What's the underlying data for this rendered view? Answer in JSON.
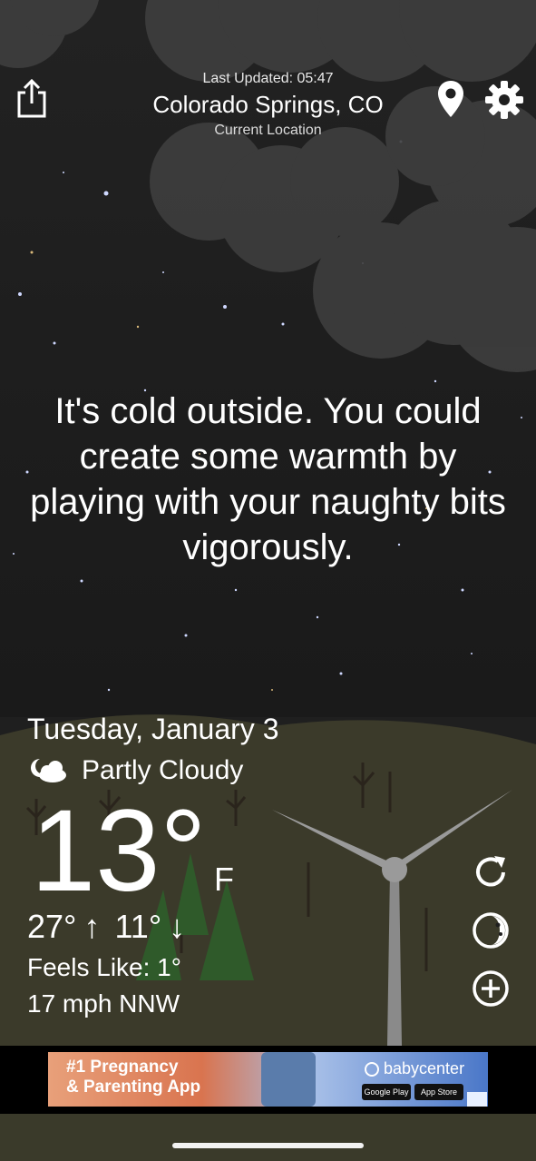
{
  "header": {
    "last_updated": "Last Updated: 05:47",
    "city": "Colorado Springs, CO",
    "location_label": "Current Location"
  },
  "icons": {
    "share": "share-icon",
    "pin": "location-pin-icon",
    "settings": "gear-icon",
    "refresh": "refresh-icon",
    "moon_phase": "moon-phase-icon",
    "add": "plus-circle-icon"
  },
  "message": "It's cold outside. You could create some warmth by playing with your naughty bits vigorously.",
  "weather": {
    "date": "Tuesday, January 3",
    "condition": "Partly Cloudy",
    "temperature": "13°",
    "unit": "F",
    "high": "27°",
    "low": "11°",
    "high_arrow": "↑",
    "low_arrow": "↓",
    "feels_like": "Feels Like: 1°",
    "wind": "17 mph NNW"
  },
  "ad": {
    "headline_line1": "#1 Pregnancy",
    "headline_line2": "& Parenting App",
    "brand": "babycenter",
    "google_play": "Google Play",
    "app_store": "App Store"
  },
  "colors": {
    "sky": "#1f1f1f",
    "cloud": "#3e3e3e",
    "ground": "#3b3a2a",
    "tree_green": "#2f5a2a"
  }
}
